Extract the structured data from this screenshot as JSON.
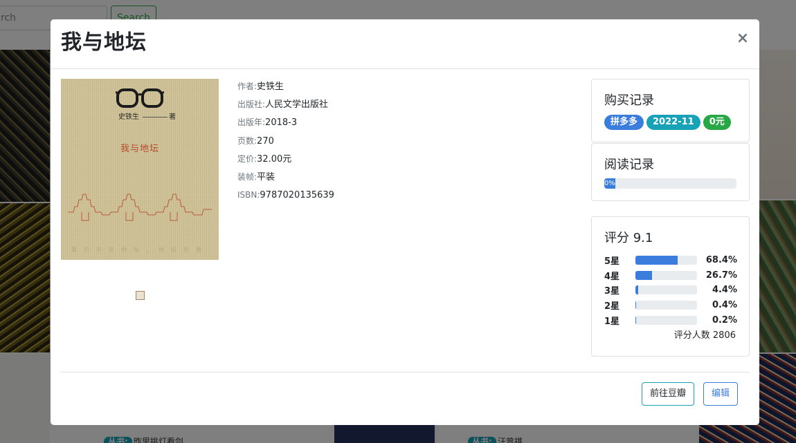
{
  "background": {
    "search_placeholder": "rch",
    "search_button": "Search",
    "series": [
      {
        "tag": "丛书:",
        "name": "昨里挑灯看剑"
      },
      {
        "tag": "丛书:",
        "name": "汪曾祺"
      }
    ]
  },
  "modal": {
    "title": "我与地坛",
    "close_label": "×",
    "cover": {
      "author": "史铁生",
      "author_suffix": "著",
      "title": "我与地坛",
      "tagline": "我已不在地坛，地坛在我"
    },
    "info": [
      {
        "label": "作者:",
        "value": "史铁生"
      },
      {
        "label": "出版社:",
        "value": "人民文学出版社"
      },
      {
        "label": "出版年:",
        "value": "2018-3"
      },
      {
        "label": "页数:",
        "value": "270"
      },
      {
        "label": "定价:",
        "value": "32.00元"
      },
      {
        "label": "装帧:",
        "value": "平装"
      },
      {
        "label": "ISBN:",
        "value": "9787020135639"
      }
    ],
    "purchase": {
      "title": "购买记录",
      "badges": [
        {
          "text": "拼多多",
          "color": "#3b7ddd"
        },
        {
          "text": "2022-11",
          "color": "#17a2b8"
        },
        {
          "text": "0元",
          "color": "#28a745"
        }
      ]
    },
    "reading": {
      "title": "阅读记录",
      "progress": 0,
      "progress_label": "0%"
    },
    "rating": {
      "title": "评分 9.1",
      "rows": [
        {
          "label": "5星",
          "value": 68.4,
          "pct": "68.4%"
        },
        {
          "label": "4星",
          "value": 26.7,
          "pct": "26.7%"
        },
        {
          "label": "3星",
          "value": 4.4,
          "pct": "4.4%"
        },
        {
          "label": "2星",
          "value": 0.4,
          "pct": "0.4%"
        },
        {
          "label": "1星",
          "value": 0.2,
          "pct": "0.2%"
        }
      ],
      "count": "评分人数 2806"
    },
    "footer": {
      "douban_label": "前往豆瓣",
      "edit_label": "编辑"
    }
  },
  "colors": {
    "primary": "#3b7ddd",
    "info": "#17a2b8",
    "success": "#28a745",
    "cover_paper": "#cfc196",
    "cover_title": "#b54a2d"
  }
}
